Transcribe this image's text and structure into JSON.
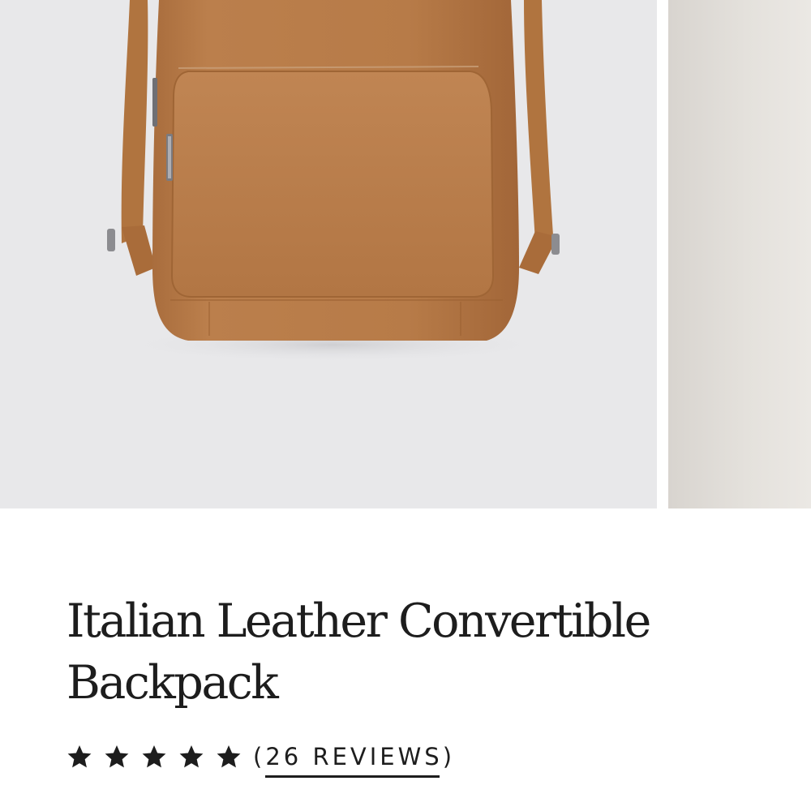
{
  "product": {
    "title": "Italian Leather Convertible Backpack",
    "rating": {
      "value": 5,
      "max": 5,
      "star_color": "#1d1d1d"
    },
    "reviews": {
      "open_paren": "(",
      "label": "26 REVIEWS",
      "close_paren": ")"
    }
  },
  "gallery": {
    "main_image": {
      "subject": "tan pebbled leather backpack",
      "background": "#e8e8ea",
      "leather_color": "#b67a48"
    },
    "next_image": {
      "background": "#e0dcd7"
    }
  }
}
